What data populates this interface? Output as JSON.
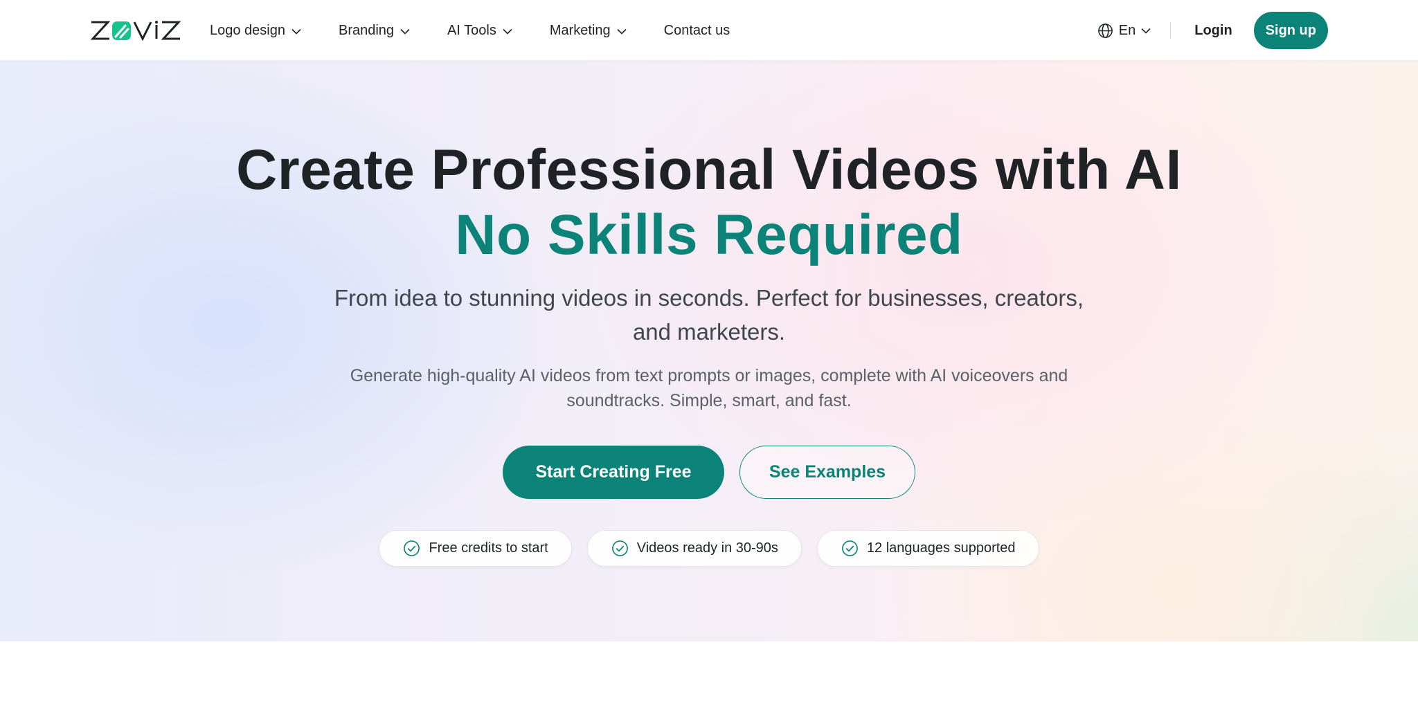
{
  "brand": {
    "name": "ZOVIZ",
    "accent_color": "#0b8378",
    "logo_icon": "zoviz-logo"
  },
  "nav": {
    "items": [
      {
        "label": "Logo design",
        "dropdown": true
      },
      {
        "label": "Branding",
        "dropdown": true
      },
      {
        "label": "AI Tools",
        "dropdown": true
      },
      {
        "label": "Marketing",
        "dropdown": true
      },
      {
        "label": "Contact us",
        "dropdown": false
      }
    ]
  },
  "header": {
    "language": "En",
    "language_icon": "globe-icon",
    "login_label": "Login",
    "signup_label": "Sign up"
  },
  "hero": {
    "title": "Create Professional Videos with AI",
    "title_accent": "No Skills Required",
    "subtitle": "From idea to stunning videos in seconds. Perfect for businesses, creators, and marketers.",
    "description": "Generate high-quality AI videos from text prompts or images, complete with AI voiceovers and soundtracks. Simple, smart, and fast.",
    "cta_primary": "Start Creating Free",
    "cta_secondary": "See Examples",
    "badges": [
      {
        "icon": "check-circle-icon",
        "label": "Free credits to start"
      },
      {
        "icon": "check-circle-icon",
        "label": "Videos ready in 30-90s"
      },
      {
        "icon": "check-circle-icon",
        "label": "12 languages supported"
      }
    ]
  }
}
